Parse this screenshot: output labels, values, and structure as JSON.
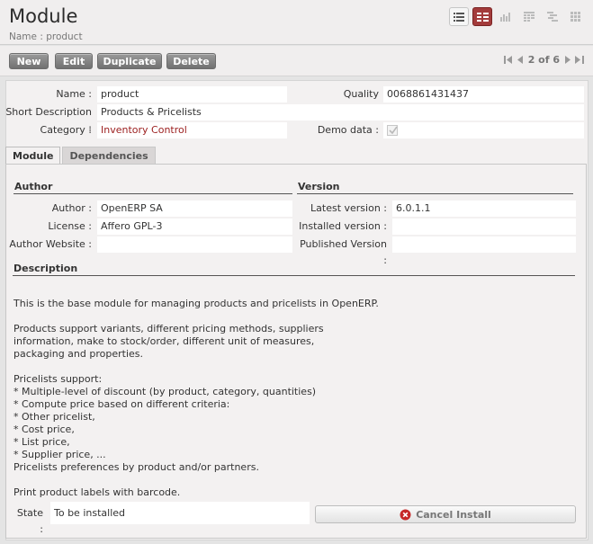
{
  "header": {
    "title": "Module",
    "subtitle": "Name : product"
  },
  "view_switcher": {
    "items": [
      {
        "name": "list-view",
        "active": false
      },
      {
        "name": "form-view",
        "active": true
      },
      {
        "name": "graph-view",
        "active": false
      },
      {
        "name": "calendar-view",
        "active": false
      },
      {
        "name": "gantt-view",
        "active": false
      },
      {
        "name": "kanban-view",
        "active": false
      }
    ],
    "active_color": "#a33b3b"
  },
  "toolbar": {
    "new_label": "New",
    "edit_label": "Edit",
    "duplicate_label": "Duplicate",
    "delete_label": "Delete",
    "pager_text": "2 of 6"
  },
  "fields": {
    "name_label": "Name :",
    "name_value": "product",
    "quality_label": "Quality Certificate :",
    "quality_value": "0068861431437",
    "short_desc_label": "Short Description :",
    "short_desc_value": "Products & Pricelists",
    "category_label": "Category :",
    "category_value": "Inventory Control",
    "demo_label": "Demo data :",
    "demo_checked": true
  },
  "tabs": [
    {
      "label": "Module",
      "active": true
    },
    {
      "label": "Dependencies",
      "active": false
    }
  ],
  "author_section": {
    "title": "Author",
    "author_label": "Author :",
    "author_value": "OpenERP SA",
    "license_label": "License :",
    "license_value": "Affero GPL-3",
    "website_label": "Author Website :",
    "website_value": ""
  },
  "version_section": {
    "title": "Version",
    "latest_label": "Latest version :",
    "latest_value": "6.0.1.1",
    "installed_label": "Installed version :",
    "installed_value": "",
    "published_label": "Published Version :",
    "published_value": ""
  },
  "description": {
    "title": "Description",
    "text": "This is the base module for managing products and pricelists in OpenERP.\n\nProducts support variants, different pricing methods, suppliers\ninformation, make to stock/order, different unit of measures,\npackaging and properties.\n\nPricelists support:\n* Multiple-level of discount (by product, category, quantities)\n* Compute price based on different criteria:\n* Other pricelist,\n* Cost price,\n* List price,\n* Supplier price, ...\nPricelists preferences by product and/or partners.\n\nPrint product labels with barcode."
  },
  "state": {
    "label": "State :",
    "value": "To be installed"
  },
  "actions": {
    "cancel_install_label": "Cancel Install"
  },
  "colors": {
    "category_link": "#9b1d1d",
    "cancel_icon": "#c62828"
  }
}
